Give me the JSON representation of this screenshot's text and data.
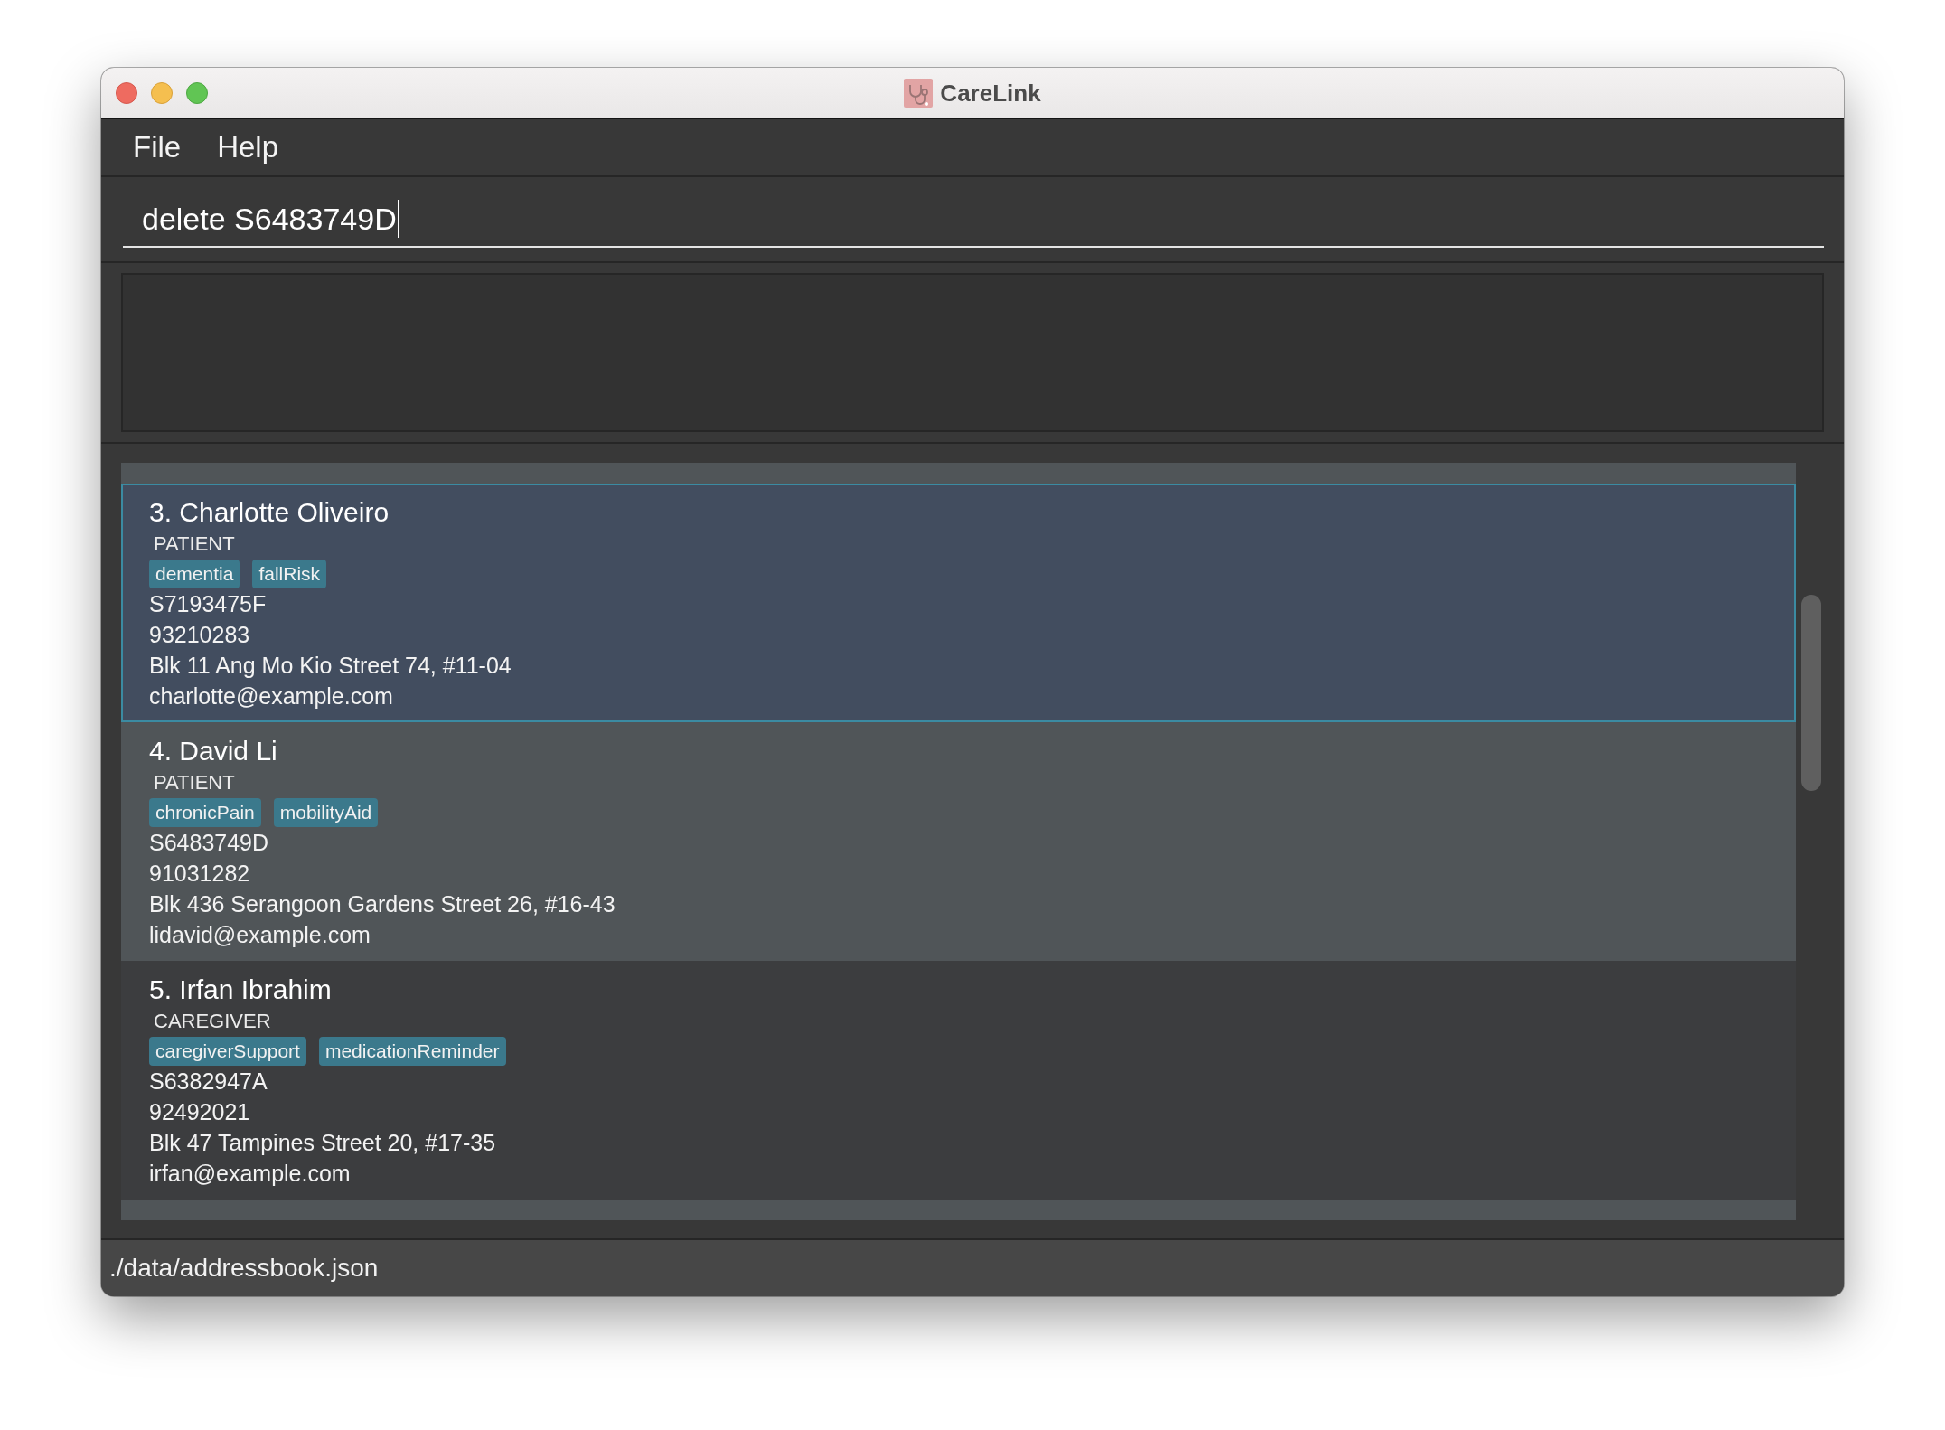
{
  "window": {
    "title": "CareLink"
  },
  "menu": [
    "File",
    "Help"
  ],
  "command_box": {
    "value": "delete S6483749D",
    "focused": true
  },
  "persons": [
    {
      "kind": "clipped",
      "selected": false
    },
    {
      "kind": "card",
      "selected": true,
      "name": "3. Charlotte Oliveiro",
      "role": "PATIENT",
      "tags": [
        "dementia",
        "fallRisk"
      ],
      "nric": "S7193475F",
      "phone": "93210283",
      "address": "Blk 11 Ang Mo Kio Street 74, #11-04",
      "email": "charlotte@example.com"
    },
    {
      "kind": "card",
      "selected": false,
      "name": "4. David Li",
      "role": "PATIENT",
      "tags": [
        "chronicPain",
        "mobilityAid"
      ],
      "nric": "S6483749D",
      "phone": "91031282",
      "address": "Blk 436 Serangoon Gardens Street 26, #16-43",
      "email": "lidavid@example.com"
    },
    {
      "kind": "card",
      "selected": false,
      "name": "5. Irfan Ibrahim",
      "role": "CAREGIVER",
      "tags": [
        "caregiverSupport",
        "medicationReminder"
      ],
      "nric": "S6382947A",
      "phone": "92492021",
      "address": "Blk 47 Tampines Street 20, #17-35",
      "email": "irfan@example.com"
    },
    {
      "kind": "clipped",
      "selected": false
    }
  ],
  "status_bar": {
    "path": "./data/addressbook.json"
  }
}
